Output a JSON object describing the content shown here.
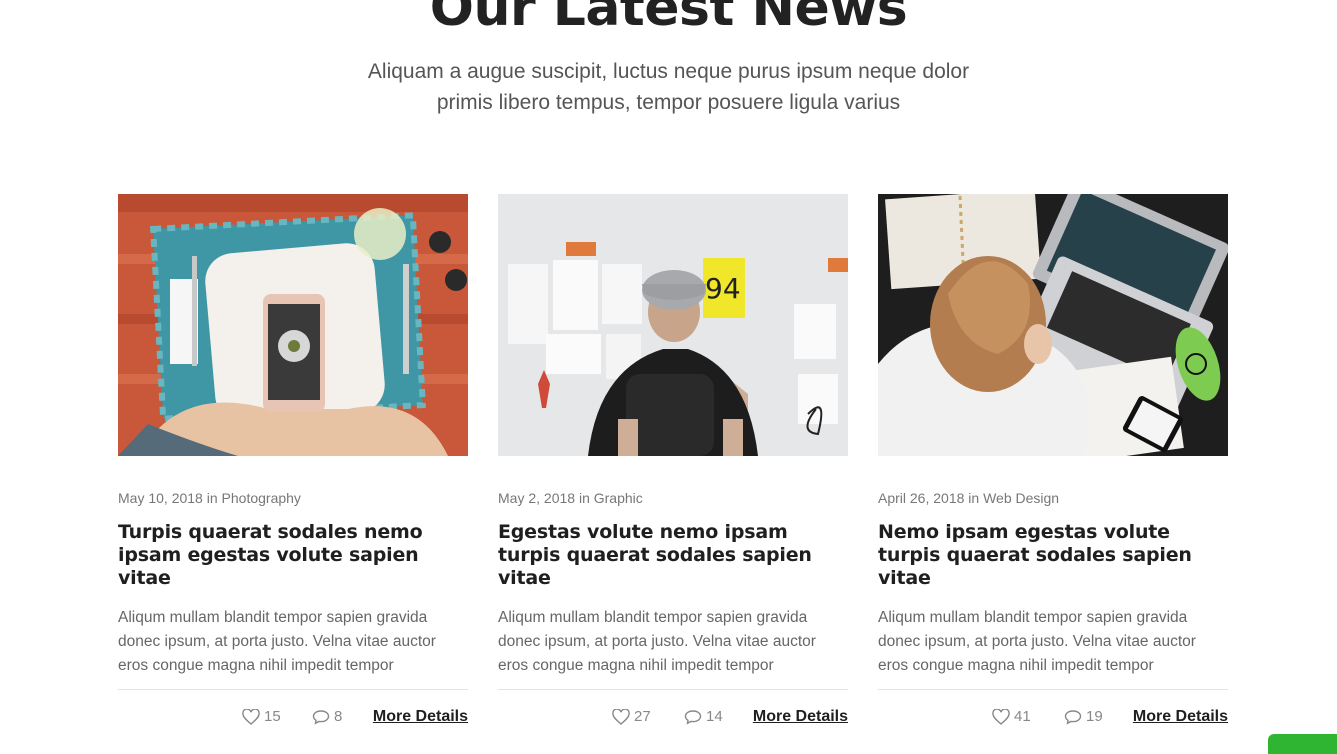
{
  "section": {
    "title": "Our Latest News",
    "subtitle_line1": "Aliquam a augue suscipit, luctus neque purus ipsum neque dolor",
    "subtitle_line2": "primis libero tempus, tempor posuere ligula varius"
  },
  "posts": [
    {
      "date": "May 10, 2018",
      "in_word": "in",
      "category": "Photography",
      "title": "Turpis quaerat sodales nemo ipsam egestas volute sapien vitae",
      "excerpt": "Aliqum mullam blandit tempor sapien gravida donec ipsum, at porta justo. Velna vitae auctor eros congue magna nihil impedit tempor",
      "likes": "15",
      "comments": "8",
      "more_label": "More Details",
      "image_icon": "food-photo-phone-image"
    },
    {
      "date": "May 2, 2018",
      "in_word": "in",
      "category": "Graphic",
      "title": "Egestas volute nemo ipsam turpis quaerat sodales sapien vitae",
      "excerpt": "Aliqum mullam blandit tempor sapien gravida donec ipsum, at porta justo. Velna vitae auctor eros congue magna nihil impedit tempor",
      "likes": "27",
      "comments": "14",
      "more_label": "More Details",
      "image_icon": "man-at-wall-image"
    },
    {
      "date": "April 26, 2018",
      "in_word": "in",
      "category": "Web Design",
      "title": "Nemo ipsam egestas volute turpis quaerat sodales sapien vitae",
      "excerpt": "Aliqum mullam blandit tempor sapien gravida donec ipsum, at porta justo. Velna vitae auctor eros congue magna nihil impedit tempor",
      "likes": "41",
      "comments": "19",
      "more_label": "More Details",
      "image_icon": "stressed-woman-laptop-image"
    }
  ],
  "colors": {
    "heading": "#222222",
    "text_muted": "#666666",
    "divider": "#e4e4e4",
    "chat_widget": "#2fb531"
  }
}
